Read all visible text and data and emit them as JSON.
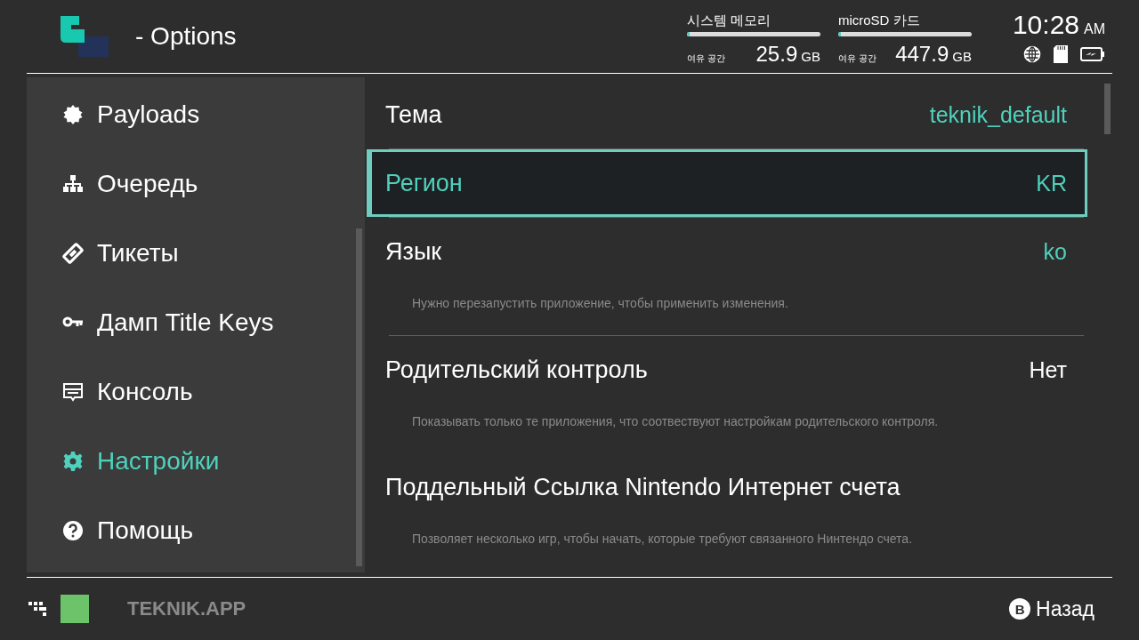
{
  "header": {
    "title": "- Options",
    "storage": [
      {
        "label": "시스템 메모리",
        "level": 0.02,
        "free_label": "여유 공간",
        "amount": "25.9",
        "unit": "GB"
      },
      {
        "label": "microSD 카드",
        "level": 0.02,
        "free_label": "여유 공간",
        "amount": "447.9",
        "unit": "GB"
      }
    ],
    "time": "10:28",
    "ampm": "AM"
  },
  "sidebar": {
    "items": [
      {
        "label": "Payloads",
        "kind": "badge",
        "selected": false
      },
      {
        "label": "Очередь",
        "kind": "tree",
        "selected": false
      },
      {
        "label": "Тикеты",
        "kind": "ticket",
        "selected": false
      },
      {
        "label": "Дамп Title Keys",
        "kind": "key",
        "selected": false
      },
      {
        "label": "Консоль",
        "kind": "console",
        "selected": false
      },
      {
        "label": "Настройки",
        "kind": "gear",
        "selected": true
      },
      {
        "label": "Помощь",
        "kind": "help",
        "selected": false
      }
    ]
  },
  "settings": [
    {
      "kind": "setting",
      "label": "Тема",
      "value": "teknik_default",
      "color": "#4fd1bc",
      "selected": false
    },
    {
      "kind": "separator"
    },
    {
      "kind": "setting",
      "label": "Регион",
      "value": "KR",
      "color": "#4fd1bc",
      "selected": true
    },
    {
      "kind": "separator"
    },
    {
      "kind": "setting",
      "label": "Язык",
      "value": "ko",
      "color": "#4fd1bc",
      "selected": false,
      "description": "Нужно перезапустить приложение, чтобы применить изменения."
    },
    {
      "kind": "separator"
    },
    {
      "kind": "setting",
      "label": "Родительский контроль",
      "value": "Нет",
      "color": "#ffffff",
      "selected": false,
      "description": "Показывать только те приложения, что соотвествуют настройкам родительского контроля."
    },
    {
      "kind": "setting",
      "label": "Поддельный Ссылка Nintendo Интернет счета",
      "selected": false,
      "description": "Позволяет несколько игр, чтобы начать, которые требуют связанного Нинтендо счета."
    }
  ],
  "footer": {
    "app_name": "TEKNIK.APP",
    "actions": [
      {
        "key": "B",
        "label": "Назад"
      }
    ]
  }
}
